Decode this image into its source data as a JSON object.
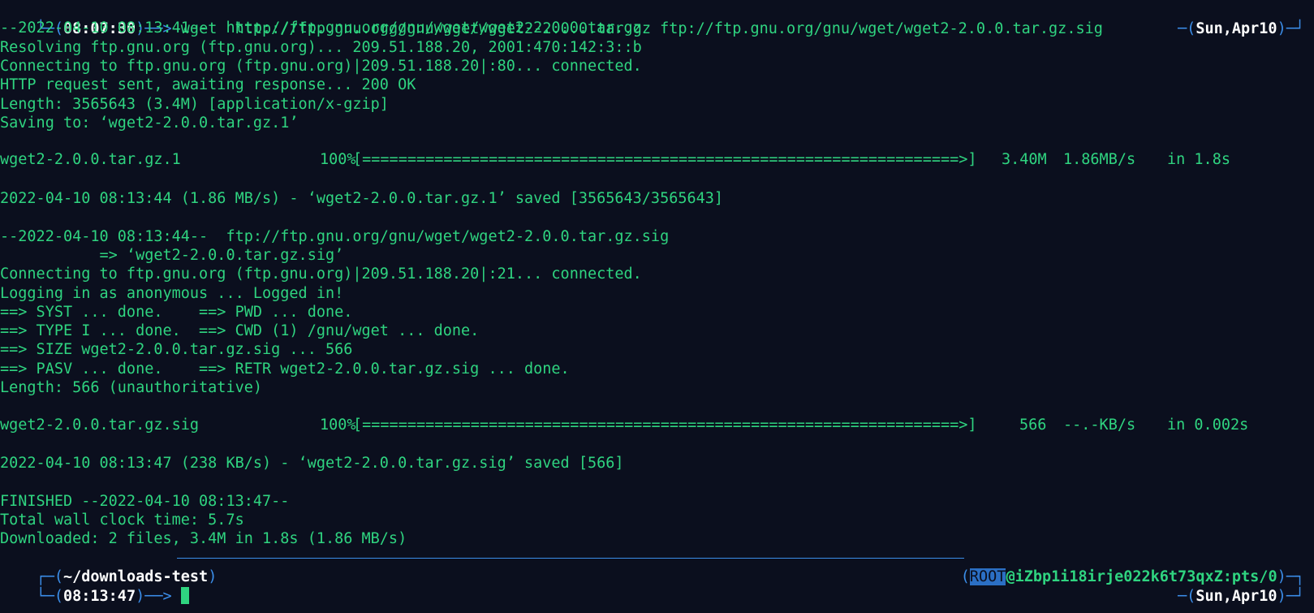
{
  "prompt_top": {
    "time": "08:07:30",
    "command": "wget  http://ftp.gnu.org/gnu/wget/wget2-2.0.0.tar.gz ftp://ftp.gnu.org/gnu/wget/wget2-2.0.0.tar.gz.sig",
    "date": "Sun,Apr10"
  },
  "output": [
    "--2022-04-10 08:13:41--  http://ftp.gnu.org/gnu/wget/wget2-2.0.0.tar.gz",
    "Resolving ftp.gnu.org (ftp.gnu.org)... 209.51.188.20, 2001:470:142:3::b",
    "Connecting to ftp.gnu.org (ftp.gnu.org)|209.51.188.20|:80... connected.",
    "HTTP request sent, awaiting response... 200 OK",
    "Length: 3565643 (3.4M) [application/x-gzip]",
    "Saving to: ‘wget2-2.0.0.tar.gz.1’",
    "",
    "",
    "",
    "2022-04-10 08:13:44 (1.86 MB/s) - ‘wget2-2.0.0.tar.gz.1’ saved [3565643/3565643]",
    "",
    "--2022-04-10 08:13:44--  ftp://ftp.gnu.org/gnu/wget/wget2-2.0.0.tar.gz.sig",
    "           => ‘wget2-2.0.0.tar.gz.sig’",
    "Connecting to ftp.gnu.org (ftp.gnu.org)|209.51.188.20|:21... connected.",
    "Logging in as anonymous ... Logged in!",
    "==> SYST ... done.    ==> PWD ... done.",
    "==> TYPE I ... done.  ==> CWD (1) /gnu/wget ... done.",
    "==> SIZE wget2-2.0.0.tar.gz.sig ... 566",
    "==> PASV ... done.    ==> RETR wget2-2.0.0.tar.gz.sig ... done.",
    "Length: 566 (unauthoritative)",
    "",
    "",
    "",
    "2022-04-10 08:13:47 (238 KB/s) - ‘wget2-2.0.0.tar.gz.sig’ saved [566]",
    "",
    "FINISHED --2022-04-10 08:13:47--",
    "Total wall clock time: 5.7s",
    "Downloaded: 2 files, 3.4M in 1.8s (1.86 MB/s)"
  ],
  "progress": [
    {
      "file": "wget2-2.0.0.tar.gz.1",
      "percent": "100%",
      "bar": "[==================================================================>]",
      "size": "3.40M",
      "speed": "1.86MB/s",
      "time": "in 1.8s"
    },
    {
      "file": "wget2-2.0.0.tar.gz.sig",
      "percent": "100%",
      "bar": "[==================================================================>]",
      "size": "566",
      "speed": "--.-KB/s",
      "time": "in 0.002s"
    }
  ],
  "prompt_bottom": {
    "cwd": "~/downloads-test",
    "user": "ROOT",
    "host": "@iZbp1i18irje022k6t73qxZ:pts/0",
    "time": "08:13:47",
    "date": "Sun,Apr10"
  },
  "colors": {
    "background": "#0b0f1e",
    "text": "#2fd480",
    "frame": "#3b8eea",
    "highlight": "#2b6fc4"
  }
}
